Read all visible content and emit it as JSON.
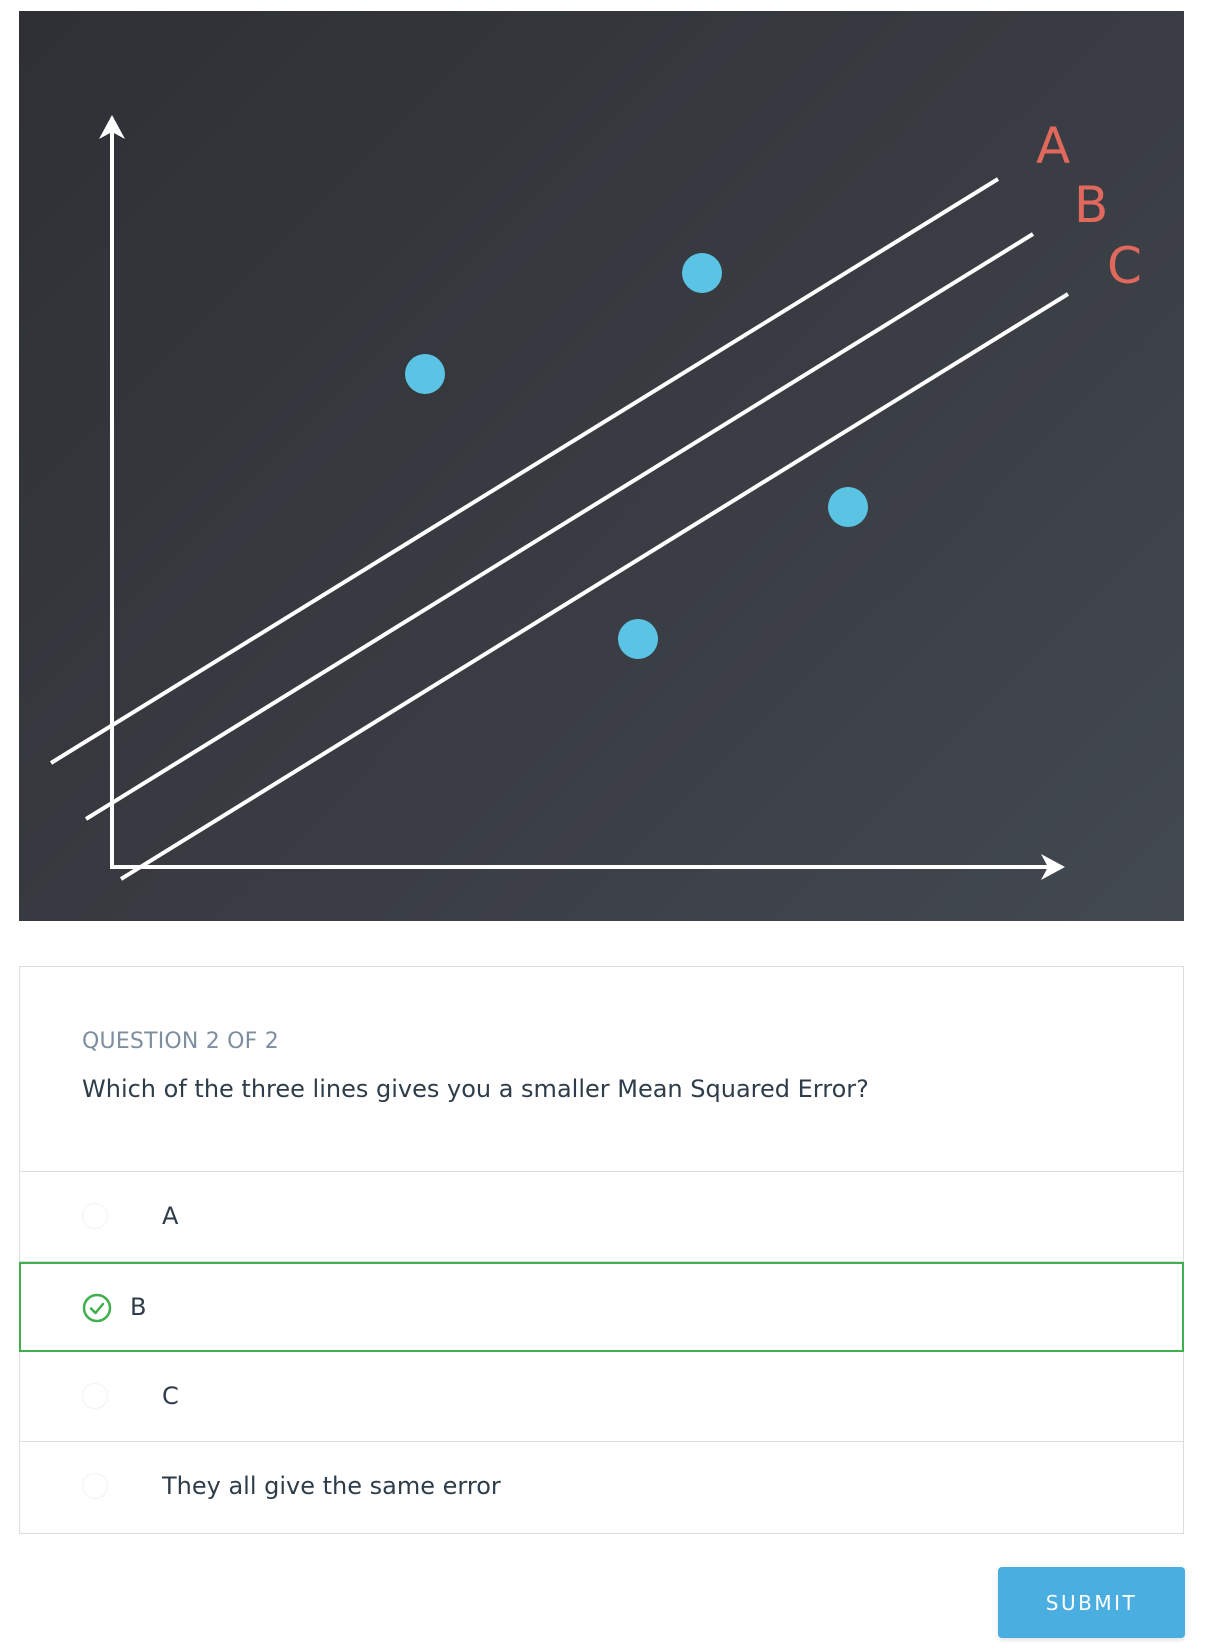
{
  "figure": {
    "line_labels": [
      "A",
      "B",
      "C"
    ],
    "label_color": "#e0685c",
    "point_color": "#5bc4e5",
    "line_color": "#ffffff"
  },
  "question": {
    "counter": "QUESTION 2 OF 2",
    "text": "Which of the three lines gives you a smaller Mean Squared Error?"
  },
  "options": [
    {
      "label": "A",
      "selected": false
    },
    {
      "label": "B",
      "selected": true
    },
    {
      "label": "C",
      "selected": false
    },
    {
      "label": "They all give the same error",
      "selected": false
    }
  ],
  "submit_label": "SUBMIT",
  "colors": {
    "accent": "#4aaee0",
    "correct": "#3fb04d",
    "text": "#2e3d49",
    "muted": "#7d8ea0"
  }
}
